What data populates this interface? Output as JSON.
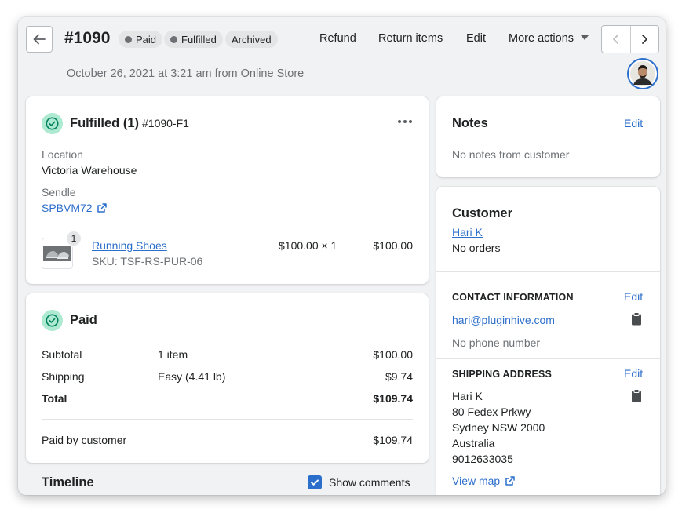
{
  "header": {
    "order_number": "#1090",
    "badges": [
      "Paid",
      "Fulfilled",
      "Archived"
    ],
    "actions": {
      "refund": "Refund",
      "return_items": "Return items",
      "edit": "Edit",
      "more_actions": "More actions"
    },
    "subline": "October 26, 2021 at 3:21 am from Online Store"
  },
  "fulfilled_card": {
    "title": "Fulfilled (1)",
    "fulfillment_id": "#1090-F1",
    "location_label": "Location",
    "location_value": "Victoria Warehouse",
    "carrier_label": "Sendle",
    "tracking_number": "SPBVM72",
    "item": {
      "quantity_badge": "1",
      "name": "Running Shoes",
      "sku": "SKU: TSF-RS-PUR-06",
      "unit_price": "$100.00 × 1",
      "total": "$100.00"
    }
  },
  "paid_card": {
    "title": "Paid",
    "rows": [
      {
        "label": "Subtotal",
        "detail": "1 item",
        "amount": "$100.00"
      },
      {
        "label": "Shipping",
        "detail": "Easy (4.41 lb)",
        "amount": "$9.74"
      },
      {
        "label": "Total",
        "detail": "",
        "amount": "$109.74"
      }
    ],
    "paid_by_label": "Paid by customer",
    "paid_by_amount": "$109.74"
  },
  "timeline": {
    "title": "Timeline",
    "show_comments_label": "Show comments",
    "show_comments_checked": true
  },
  "notes_card": {
    "title": "Notes",
    "edit": "Edit",
    "text": "No notes from customer"
  },
  "customer_card": {
    "title": "Customer",
    "name": "Hari K",
    "orders": "No orders",
    "contact_heading": "CONTACT INFORMATION",
    "contact_edit": "Edit",
    "email": "hari@pluginhive.com",
    "phone": "No phone number",
    "shipping_heading": "SHIPPING ADDRESS",
    "shipping_edit": "Edit",
    "address_lines": [
      "Hari K",
      "80 Fedex Prkwy",
      "Sydney NSW 2000",
      "Australia",
      "9012633035"
    ],
    "view_map": "View map"
  },
  "colors": {
    "accent": "#2c6ecb",
    "success_bg": "#aee9d1",
    "success_icon": "#007f5f",
    "page_bg": "#f1f2f3"
  }
}
